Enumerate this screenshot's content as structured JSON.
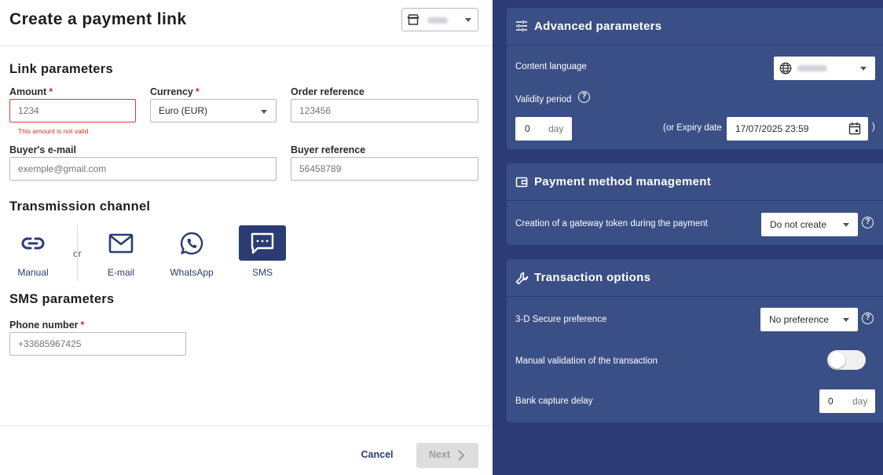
{
  "header": {
    "title": "Create a payment link",
    "shop_select_icon": "store-icon"
  },
  "link_parameters": {
    "heading": "Link parameters",
    "amount": {
      "label": "Amount",
      "required_mark": "*",
      "placeholder": "1234",
      "error": "This amount is not valid"
    },
    "currency": {
      "label": "Currency",
      "required_mark": "*",
      "value": "Euro (EUR)"
    },
    "order_reference": {
      "label": "Order reference",
      "placeholder": "123456"
    },
    "buyer_email": {
      "label": "Buyer's e-mail",
      "placeholder": "exemple@gmail.com"
    },
    "buyer_reference": {
      "label": "Buyer reference",
      "placeholder": "56458789"
    }
  },
  "transmission": {
    "heading": "Transmission channel",
    "or_text": "or",
    "channels": [
      {
        "label": "Manual",
        "icon": "link-icon",
        "active": false
      },
      {
        "label": "E-mail",
        "icon": "mail-icon",
        "active": false
      },
      {
        "label": "WhatsApp",
        "icon": "whatsapp-icon",
        "active": false
      },
      {
        "label": "SMS",
        "icon": "sms-icon",
        "active": true
      }
    ]
  },
  "sms_parameters": {
    "heading": "SMS parameters",
    "phone": {
      "label": "Phone number",
      "required_mark": "*",
      "placeholder": "+33685967425"
    }
  },
  "footer": {
    "cancel_label": "Cancel",
    "next_label": "Next"
  },
  "advanced": {
    "heading": "Advanced parameters",
    "icon": "sliders-icon",
    "content_language_label": "Content language",
    "language_icon": "globe-icon",
    "validity_label": "Validity period",
    "validity_value": "0",
    "validity_unit": "day",
    "expiry_label": "(or Expiry date",
    "expiry_value": "17/07/2025 23:59",
    "expiry_close": ")"
  },
  "payment_method": {
    "heading": "Payment method management",
    "icon": "wallet-icon",
    "token_label": "Creation of a gateway token during the payment",
    "token_value": "Do not create"
  },
  "transaction": {
    "heading": "Transaction options",
    "icon": "wrench-icon",
    "secure_label": "3-D Secure preference",
    "secure_value": "No preference",
    "manual_validation_label": "Manual validation of the transaction",
    "manual_validation_on": false,
    "capture_label": "Bank capture delay",
    "capture_value": "0",
    "capture_unit": "day"
  },
  "colors": {
    "primary": "#2b3c73",
    "panel_bg": "#2c3b73",
    "card_bg": "#3a4f85",
    "error": "#d32f2f"
  }
}
